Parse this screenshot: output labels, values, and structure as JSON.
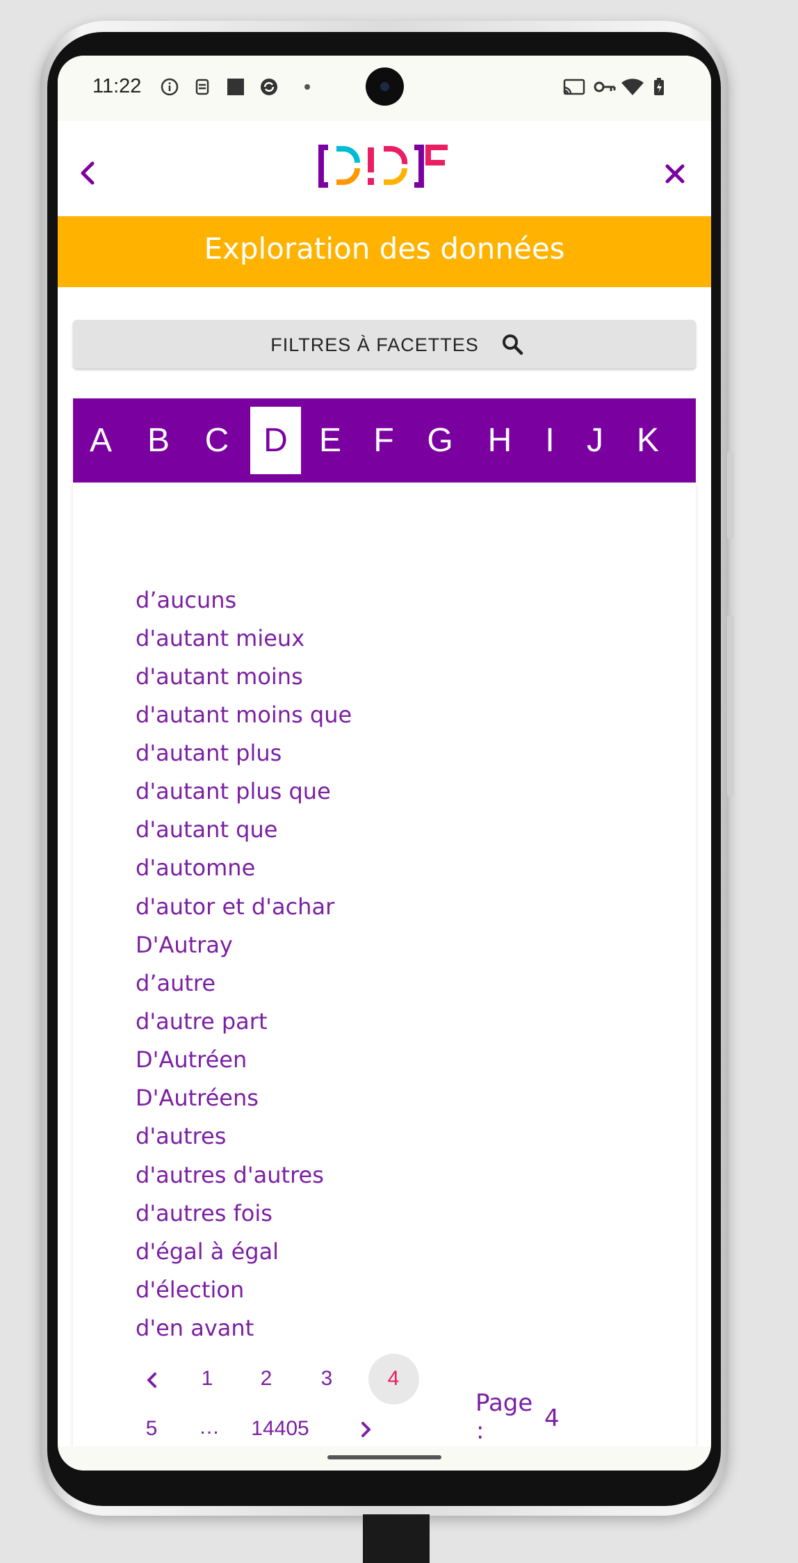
{
  "status_bar": {
    "time": "11:22"
  },
  "header": {
    "banner_title": "Exploration des données"
  },
  "filters": {
    "label": "FILTRES À FACETTES"
  },
  "alphabet": {
    "letters": [
      "A",
      "B",
      "C",
      "D",
      "E",
      "F",
      "G",
      "H",
      "I",
      "J",
      "K"
    ],
    "active": "D"
  },
  "words": [
    "d’aucuns",
    "d'autant mieux",
    "d'autant moins",
    "d'autant moins que",
    "d'autant plus",
    "d'autant plus que",
    "d'autant que",
    "d'automne",
    "d'autor et d'achar",
    "D'Autray",
    "d’autre",
    "d'autre part",
    "D'Autréen",
    "D'Autréens",
    "d'autres",
    "d'autres d'autres",
    "d'autres fois",
    "d'égal à égal",
    "d'élection",
    "d'en avant"
  ],
  "pagination": {
    "pages": [
      "1",
      "2",
      "3",
      "4",
      "5"
    ],
    "ellipsis": "…",
    "last": "14405",
    "current": "4",
    "page_label": "Page",
    "page_colon": ":",
    "page_value": "4"
  },
  "colors": {
    "brand_purple": "#7b00a0",
    "banner_yellow": "#ffb300",
    "active_page": "#e91e63"
  }
}
